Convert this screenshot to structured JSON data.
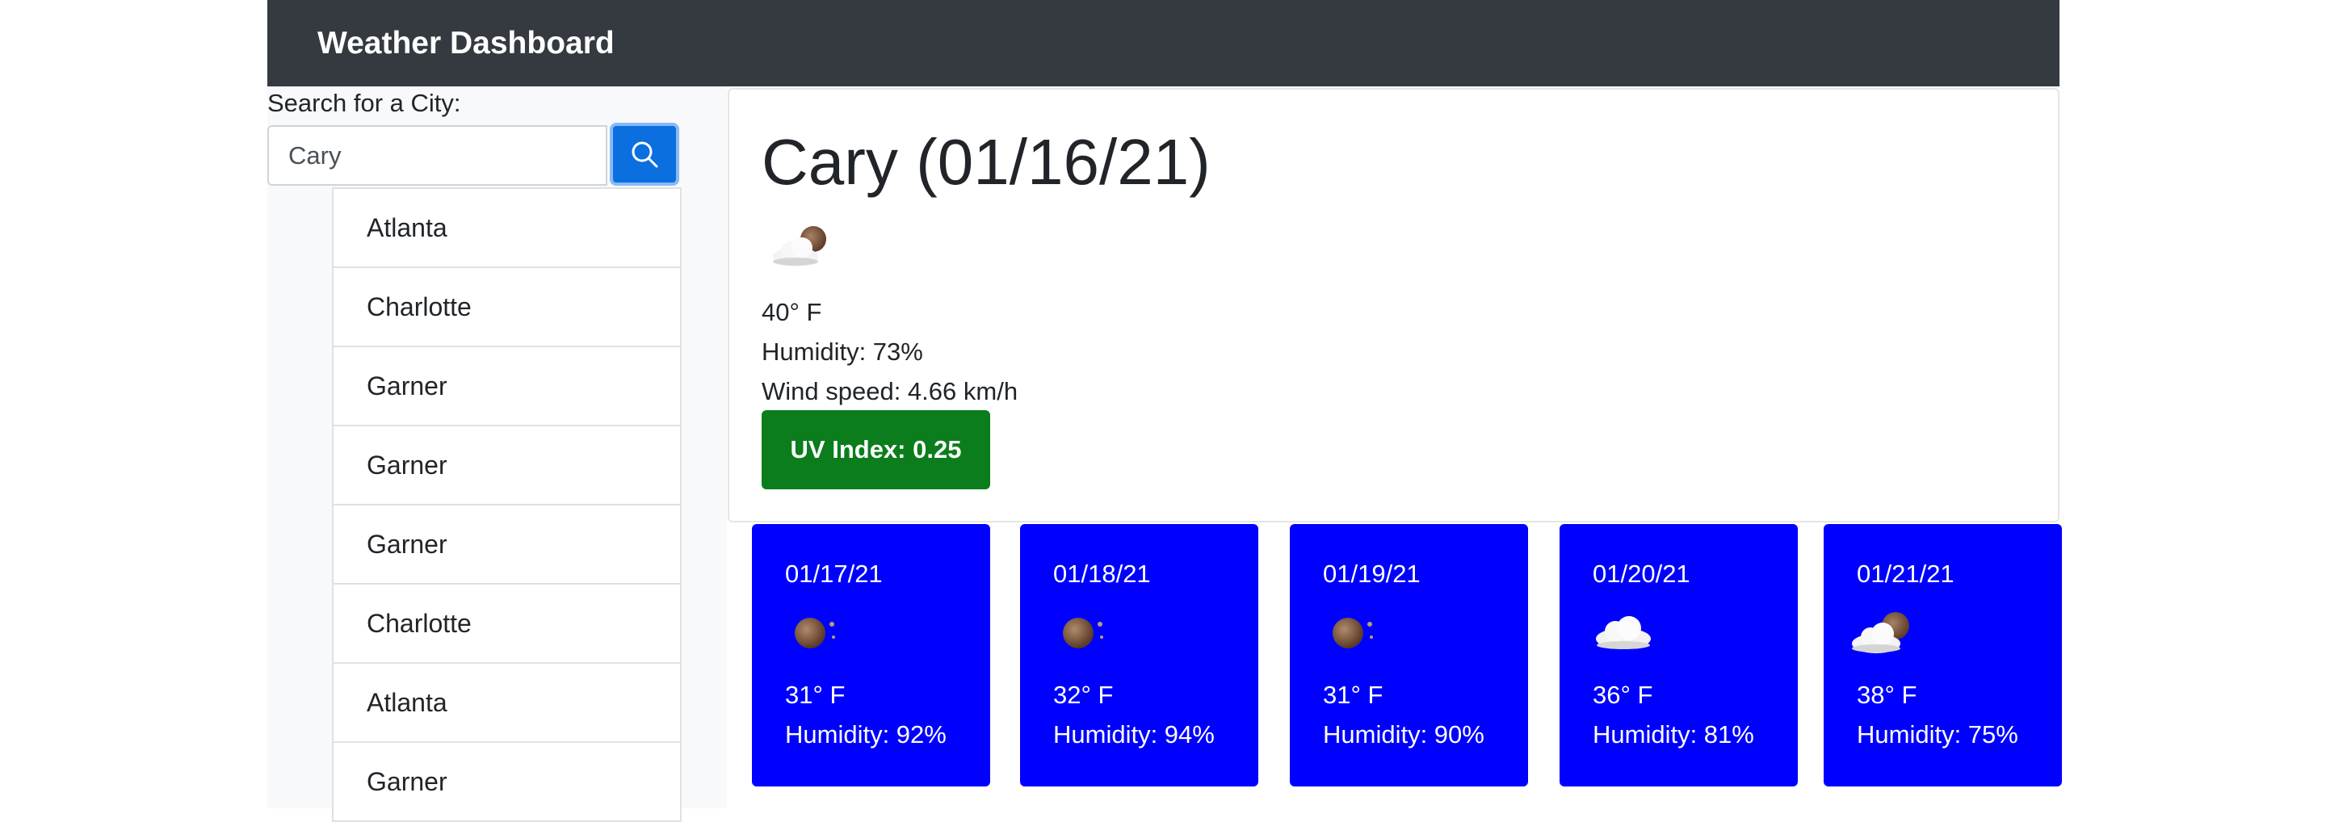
{
  "navbar": {
    "brand": "Weather Dashboard"
  },
  "search": {
    "label": "Search for a City:",
    "value": "Cary",
    "button_icon": "search-icon"
  },
  "history": [
    "Atlanta",
    "Charlotte",
    "Garner",
    "Garner",
    "Garner",
    "Charlotte",
    "Atlanta",
    "Garner"
  ],
  "current": {
    "title": "Cary (01/16/21)",
    "icon": "partly-cloudy-night-icon",
    "temp": "40° F",
    "humidity": "Humidity: 73%",
    "wind": "Wind speed: 4.66 km/h",
    "uv": "UV Index: 0.25",
    "uv_color": "#0b7d1c"
  },
  "forecast": [
    {
      "date": "01/17/21",
      "icon": "moon-icon",
      "temp": "31° F",
      "humidity": "Humidity: 92%"
    },
    {
      "date": "01/18/21",
      "icon": "moon-icon",
      "temp": "32° F",
      "humidity": "Humidity: 94%"
    },
    {
      "date": "01/19/21",
      "icon": "moon-icon",
      "temp": "31° F",
      "humidity": "Humidity: 90%"
    },
    {
      "date": "01/20/21",
      "icon": "cloud-icon",
      "temp": "36° F",
      "humidity": "Humidity: 81%"
    },
    {
      "date": "01/21/21",
      "icon": "partly-cloudy-night-icon",
      "temp": "38° F",
      "humidity": "Humidity: 75%"
    }
  ],
  "colors": {
    "navbar": "#343a40",
    "forecast_card": "#0000fe",
    "search_button": "#0b6fe0"
  }
}
